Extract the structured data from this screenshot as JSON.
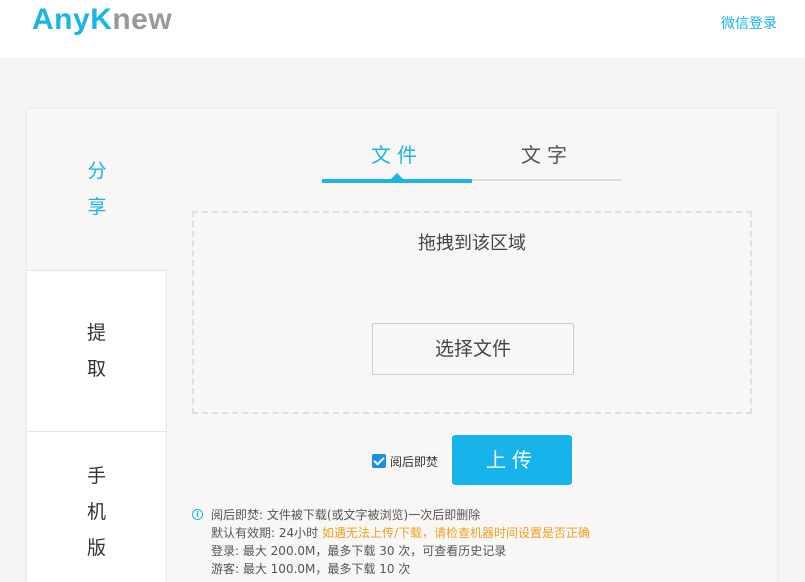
{
  "header": {
    "logo_part1": "Any",
    "logo_part2": "K",
    "logo_part3": "new",
    "login_link": "微信登录"
  },
  "sidebar": {
    "items": [
      {
        "chars": [
          "分",
          "享"
        ]
      },
      {
        "chars": [
          "提",
          "取"
        ]
      },
      {
        "chars": [
          "手",
          "机",
          "版"
        ]
      }
    ]
  },
  "tabs": [
    {
      "label": "文件"
    },
    {
      "label": "文字"
    }
  ],
  "dropzone": {
    "hint": "拖拽到该区域",
    "choose_label": "选择文件"
  },
  "burn_after_read": {
    "label": "阅后即焚",
    "checked": true
  },
  "upload_label": "上传",
  "notes": {
    "line1": "阅后即焚: 文件被下载(或文字被浏览)一次后即删除",
    "line2_prefix": "默认有效期: 24小时",
    "line2_warning": "如遇无法上传/下载，请检查机器时间设置是否正确",
    "line3": "登录: 最大 200.0M，最多下载 30 次，可查看历史记录",
    "line4": "游客: 最大 100.0M，最多下载 10 次"
  },
  "colors": {
    "accent": "#1ab5e8",
    "warning": "#f0a01e",
    "checkbox": "#1a8fe8"
  }
}
